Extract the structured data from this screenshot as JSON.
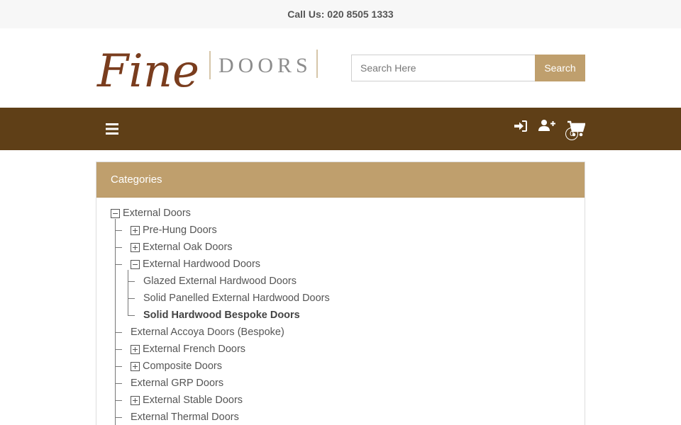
{
  "topbar": {
    "call_text": "Call Us: 020 8505 1333"
  },
  "logo": {
    "script_text": "Fine",
    "word_text": "DOORS"
  },
  "search": {
    "placeholder": "Search Here",
    "button_label": "Search"
  },
  "nav": {
    "menu_icon": "hamburger-icon",
    "login_icon": "sign-in-icon",
    "register_icon": "user-plus-icon",
    "cart_icon": "shopping-cart-icon",
    "cart_count": "0"
  },
  "categories": {
    "heading": "Categories",
    "items": [
      {
        "label": "External Doors",
        "toggle": "minus",
        "level": 0
      },
      {
        "label": "Pre-Hung Doors",
        "toggle": "plus",
        "level": 1
      },
      {
        "label": "External Oak Doors",
        "toggle": "plus",
        "level": 1
      },
      {
        "label": "External Hardwood Doors",
        "toggle": "minus",
        "level": 1
      },
      {
        "label": "Glazed External Hardwood Doors",
        "toggle": "none",
        "level": 2
      },
      {
        "label": "Solid Panelled External Hardwood Doors",
        "toggle": "none",
        "level": 2
      },
      {
        "label": "Solid Hardwood Bespoke Doors",
        "toggle": "none",
        "level": 2,
        "active": true
      },
      {
        "label": "External Accoya Doors (Bespoke)",
        "toggle": "none",
        "level": 1
      },
      {
        "label": "External French Doors",
        "toggle": "plus",
        "level": 1
      },
      {
        "label": "Composite Doors",
        "toggle": "plus",
        "level": 1
      },
      {
        "label": "External GRP Doors",
        "toggle": "none",
        "level": 1
      },
      {
        "label": "External Stable Doors",
        "toggle": "plus",
        "level": 1
      },
      {
        "label": "External Thermal Doors",
        "toggle": "none",
        "level": 1
      }
    ]
  },
  "colors": {
    "brand_brown": "#5f3f17",
    "accent_gold": "#bf9f6d",
    "topbar_bg": "#f7f7f7"
  }
}
